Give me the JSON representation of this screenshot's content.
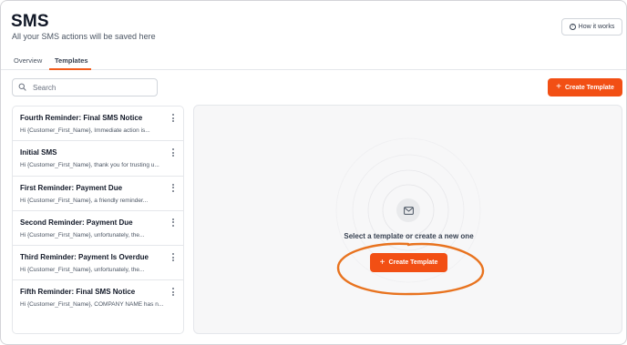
{
  "page": {
    "title": "SMS",
    "subtitle": "All your SMS actions will be saved here",
    "how_it_works_label": "How it works"
  },
  "tabs": [
    {
      "label": "Overview",
      "active": false
    },
    {
      "label": "Templates",
      "active": true
    }
  ],
  "search": {
    "placeholder": "Search",
    "value": ""
  },
  "create_template_label": "Create Template",
  "templates": [
    {
      "title": "Fourth Reminder: Final SMS Notice",
      "preview": "Hi {Customer_First_Name}, Immediate action is..."
    },
    {
      "title": "Initial SMS",
      "preview": "Hi {Customer_First_Name}, thank you for trusting u..."
    },
    {
      "title": "First Reminder: Payment Due",
      "preview": "Hi {Customer_First_Name}, a friendly reminder..."
    },
    {
      "title": "Second Reminder: Payment Due",
      "preview": "Hi {Customer_First_Name}, unfortunately, the..."
    },
    {
      "title": "Third Reminder: Payment Is Overdue",
      "preview": "Hi {Customer_First_Name}, unfortunately, the..."
    },
    {
      "title": "Fifth Reminder: Final SMS Notice",
      "preview": "Hi {Customer_First_Name}, COMPANY NAME has n..."
    }
  ],
  "empty_state": {
    "message": "Select a template or create a new one",
    "button_label": "Create Template"
  },
  "colors": {
    "accent": "#f24f14",
    "annotation": "#e8731f"
  },
  "icons": {
    "help": "question-circle-icon",
    "search": "search-icon",
    "plus": "plus-icon",
    "menu": "kebab-menu-icon",
    "mail": "mail-icon"
  }
}
